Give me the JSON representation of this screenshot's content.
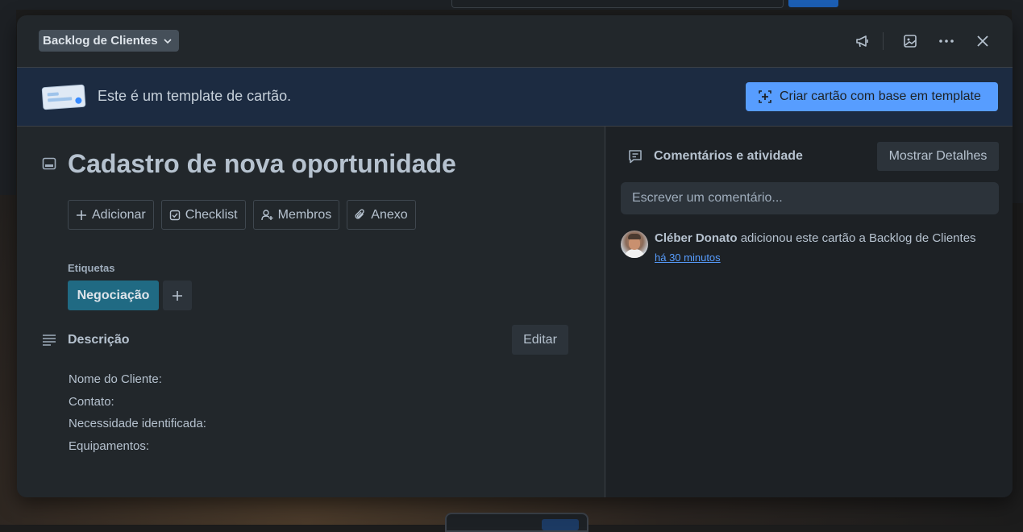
{
  "header": {
    "list_name": "Backlog de Clientes",
    "icons": [
      "megaphone-icon",
      "image-icon",
      "more-icon",
      "close-icon"
    ]
  },
  "banner": {
    "text": "Este é um template de cartão.",
    "create_button": "Criar cartão com base em template"
  },
  "card": {
    "title": "Cadastro de nova oportunidade",
    "actions": [
      {
        "label": "Adicionar",
        "icon": "plus-icon"
      },
      {
        "label": "Checklist",
        "icon": "checkbox-icon"
      },
      {
        "label": "Membros",
        "icon": "add-member-icon"
      },
      {
        "label": "Anexo",
        "icon": "paperclip-icon"
      }
    ],
    "labels_title": "Etiquetas",
    "labels": [
      {
        "name": "Negociação",
        "color": "#206a83"
      }
    ],
    "description_title": "Descrição",
    "edit_button": "Editar",
    "description_lines": [
      "Nome do Cliente:",
      "Contato:",
      "Necessidade identificada:",
      "Equipamentos:"
    ]
  },
  "activity": {
    "title": "Comentários e atividade",
    "details_button": "Mostrar Detalhes",
    "comment_placeholder": "Escrever um comentário...",
    "entries": [
      {
        "user": "Cléber Donato",
        "text": "adicionou este cartão a Backlog de Clientes",
        "time": "há 30 minutos"
      }
    ]
  },
  "colors": {
    "accent": "#579dff",
    "modal_bg": "#22272b",
    "banner_bg": "#1c2b41"
  }
}
